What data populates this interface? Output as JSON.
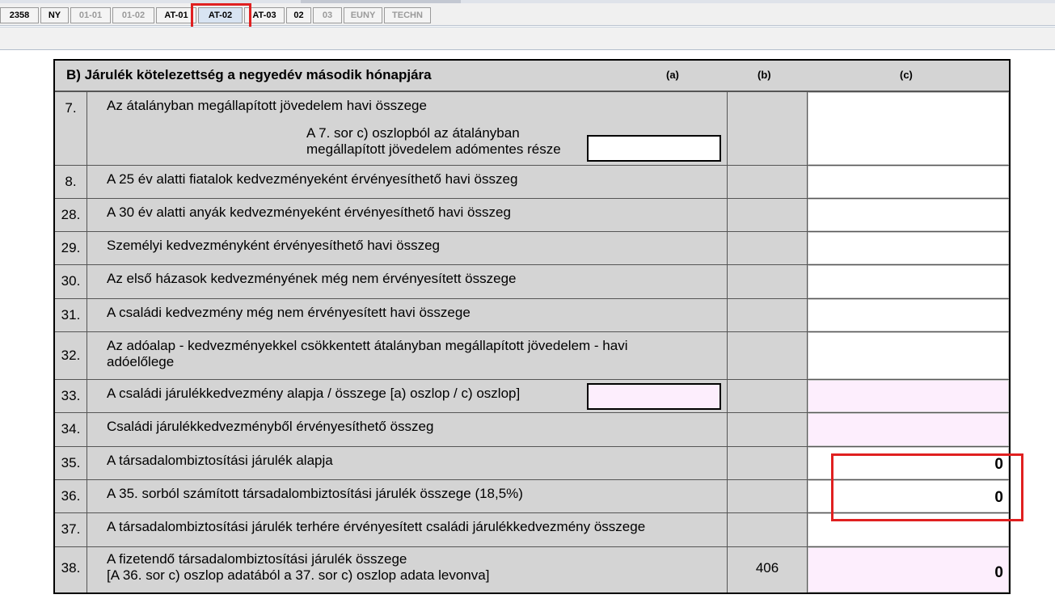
{
  "tabs": [
    {
      "label": "2358",
      "state": "normal"
    },
    {
      "label": "NY",
      "state": "normal"
    },
    {
      "label": "01-01",
      "state": "disabled"
    },
    {
      "label": "01-02",
      "state": "disabled"
    },
    {
      "label": "AT-01",
      "state": "normal"
    },
    {
      "label": "AT-02",
      "state": "selected"
    },
    {
      "label": "AT-03",
      "state": "normal"
    },
    {
      "label": "02",
      "state": "normal"
    },
    {
      "label": "03",
      "state": "disabled"
    },
    {
      "label": "EUNY",
      "state": "disabled"
    },
    {
      "label": "TECHN",
      "state": "disabled"
    }
  ],
  "section": {
    "title": "B) Járulék kötelezettség a negyedév második hónapjára",
    "col_a": "(a)",
    "col_b": "(b)",
    "col_c": "(c)"
  },
  "rows": [
    {
      "num": "7.",
      "label": "Az átalányban megállapított jövedelem havi összege",
      "sub_label_1": "A 7. sor c) oszlopból az átalányban",
      "sub_label_2": "megállapított jövedelem adómentes része",
      "b": "",
      "c": ""
    },
    {
      "num": "8.",
      "label": "A 25 év alatti fiatalok kedvezményeként érvényesíthető havi összeg",
      "b": "",
      "c": ""
    },
    {
      "num": "28.",
      "label": "A 30 év alatti anyák kedvezményeként érvényesíthető havi összeg",
      "b": "",
      "c": ""
    },
    {
      "num": "29.",
      "label": "Személyi kedvezményként érvényesíthető havi összeg",
      "b": "",
      "c": ""
    },
    {
      "num": "30.",
      "label": "Az első házasok kedvezményének még nem érvényesített összege",
      "b": "",
      "c": ""
    },
    {
      "num": "31.",
      "label": "A családi kedvezmény még nem érvényesített havi összege",
      "b": "",
      "c": ""
    },
    {
      "num": "32.",
      "label": "Az adóalap - kedvezményekkel csökkentett átalányban megállapított jövedelem - havi",
      "label_2": "adóelőlege",
      "b": "",
      "c": ""
    },
    {
      "num": "33.",
      "label": "A családi járulékkedvezmény alapja / összege [a) oszlop / c) oszlop]",
      "b": "",
      "c": ""
    },
    {
      "num": "34.",
      "label": "Családi járulékkedvezményből érvényesíthető összeg",
      "b": "",
      "c": ""
    },
    {
      "num": "35.",
      "label": "A társadalombiztosítási járulék alapja",
      "b": "",
      "c": "0"
    },
    {
      "num": "36.",
      "label": "A 35. sorból számított társadalombiztosítási járulék összege (18,5%)",
      "b": "",
      "c": "0"
    },
    {
      "num": "37.",
      "label": "A társadalombiztosítási járulék terhére érvényesített családi járulékkedvezmény összege",
      "b": "",
      "c": ""
    },
    {
      "num": "38.",
      "label": "A fizetendő társadalombiztosítási járulék összege",
      "label_2": "[A 36. sor c) oszlop adatából a 37. sor c) oszlop adata levonva]",
      "b": "406",
      "c": "0"
    }
  ],
  "colors": {
    "highlight_red": "#e02020",
    "readonly_pink": "#fdeefd",
    "form_gray": "#d4d4d4"
  }
}
